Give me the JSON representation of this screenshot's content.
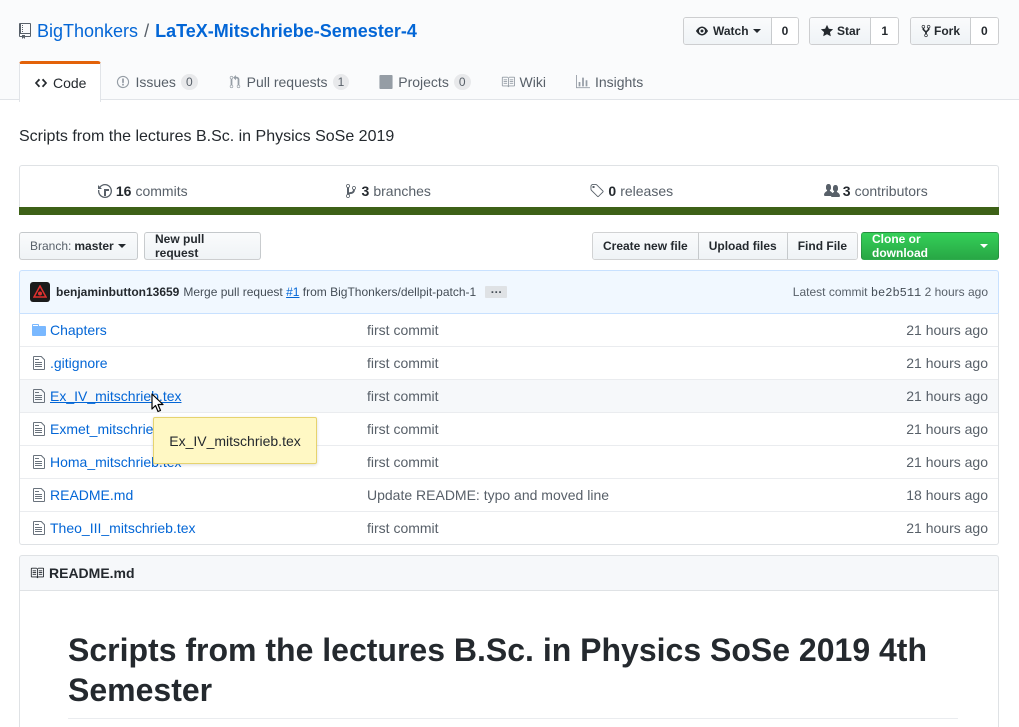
{
  "repo": {
    "owner": "BigThonkers",
    "separator": "/",
    "name": "LaTeX-Mitschriebe-Semester-4"
  },
  "actions": {
    "watch": {
      "label": "Watch",
      "count": "0"
    },
    "star": {
      "label": "Star",
      "count": "1"
    },
    "fork": {
      "label": "Fork",
      "count": "0"
    }
  },
  "tabs": [
    {
      "label": "Code",
      "selected": true
    },
    {
      "label": "Issues",
      "count": "0"
    },
    {
      "label": "Pull requests",
      "count": "1"
    },
    {
      "label": "Projects",
      "count": "0"
    },
    {
      "label": "Wiki"
    },
    {
      "label": "Insights"
    }
  ],
  "description": "Scripts from the lectures B.Sc. in Physics SoSe 2019",
  "summary": {
    "commits": {
      "count": "16",
      "label": "commits"
    },
    "branches": {
      "count": "3",
      "label": "branches"
    },
    "releases": {
      "count": "0",
      "label": "releases"
    },
    "contributors": {
      "count": "3",
      "label": "contributors"
    }
  },
  "language_color": "#3d6117",
  "branch": {
    "prefix": "Branch:",
    "name": "master"
  },
  "buttons": {
    "new_pull_request": "New pull request",
    "create_new_file": "Create new file",
    "upload_files": "Upload files",
    "find_file": "Find File",
    "clone": "Clone or download"
  },
  "latest_commit": {
    "author": "benjaminbutton13659",
    "message_prefix": "Merge pull request",
    "pr_link": "#1",
    "message_suffix": "from BigThonkers/dellpit-patch-1",
    "ellipsis": "…",
    "label": "Latest commit",
    "sha": "be2b511",
    "age": "2 hours ago"
  },
  "files": [
    {
      "name": "Chapters",
      "type": "dir",
      "message": "first commit",
      "age": "21 hours ago"
    },
    {
      "name": ".gitignore",
      "type": "file",
      "message": "first commit",
      "age": "21 hours ago"
    },
    {
      "name": "Ex_IV_mitschrieb.tex",
      "type": "file",
      "message": "first commit",
      "age": "21 hours ago"
    },
    {
      "name": "Exmet_mitschrieb.tex",
      "type": "file",
      "message": "first commit",
      "age": "21 hours ago"
    },
    {
      "name": "Homa_mitschrieb.tex",
      "type": "file",
      "message": "first commit",
      "age": "21 hours ago"
    },
    {
      "name": "README.md",
      "type": "file",
      "message": "Update README: typo and moved line",
      "age": "18 hours ago"
    },
    {
      "name": "Theo_III_mitschrieb.tex",
      "type": "file",
      "message": "first commit",
      "age": "21 hours ago"
    }
  ],
  "tooltip": "Ex_IV_mitschrieb.tex",
  "readme": {
    "filename": "README.md",
    "heading": "Scripts from the lectures B.Sc. in Physics SoSe 2019 4th Semester"
  }
}
